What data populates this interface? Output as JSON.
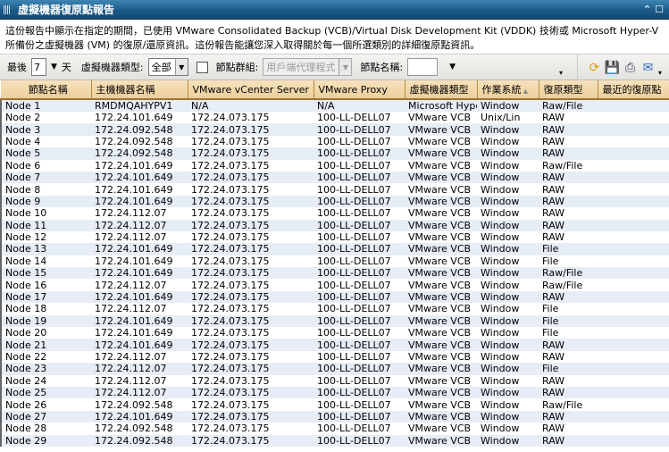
{
  "title": "虛擬機器復原點報告",
  "description": "這份報告中顯示在指定的期間，已使用 VMware Consolidated Backup (VCB)/Virtual Disk Development Kit (VDDK) 技術或 Microsoft Hyper-V 所備份之虛擬機器 (VM) 的復原/還原資訊。這份報告能讓您深入取得關於每一個所選類別的詳細復原點資訊。",
  "toolbar": {
    "last_label": "最後",
    "days_value": "7",
    "days_unit": "天",
    "vm_type_label": "虛擬機器類型:",
    "vm_type_value": "全部",
    "node_group_label": "節點群組:",
    "node_group_value": "用戶端代理程式",
    "node_name_label": "節點名稱:",
    "node_name_value": ""
  },
  "icons": [
    "refresh-icon",
    "save-icon",
    "print-icon",
    "email-icon"
  ],
  "columns": [
    "節點名稱",
    "主機機器名稱",
    "VMware vCenter Server",
    "VMware Proxy",
    "虛擬機器類型",
    "作業系統",
    "復原類型",
    "最近的復原點"
  ],
  "rows": [
    [
      "Node 1",
      "RMDMQAHYPV1",
      "N/A",
      "N/A",
      "Microsoft Hyper-V",
      "Window",
      "Raw/File",
      ""
    ],
    [
      "Node 2",
      "172.24.101.649",
      "172.24.073.175",
      "100-LL-DELL07",
      "VMware VCB",
      "Unix/Lin",
      "RAW",
      ""
    ],
    [
      "Node 3",
      "172.24.092.548",
      "172.24.073.175",
      "100-LL-DELL07",
      "VMware VCB",
      "Window",
      "RAW",
      ""
    ],
    [
      "Node 4",
      "172.24.092.548",
      "172.24.073.175",
      "100-LL-DELL07",
      "VMware VCB",
      "Window",
      "RAW",
      ""
    ],
    [
      "Node 5",
      "172.24.092.548",
      "172.24.073.175",
      "100-LL-DELL07",
      "VMware VCB",
      "Window",
      "RAW",
      ""
    ],
    [
      "Node 6",
      "172.24.101.649",
      "172.24.073.175",
      "100-LL-DELL07",
      "VMware VCB",
      "Window",
      "Raw/File",
      ""
    ],
    [
      "Node 7",
      "172.24.101.649",
      "172.24.073.175",
      "100-LL-DELL07",
      "VMware VCB",
      "Window",
      "RAW",
      ""
    ],
    [
      "Node 8",
      "172.24.101.649",
      "172.24.073.175",
      "100-LL-DELL07",
      "VMware VCB",
      "Window",
      "RAW",
      ""
    ],
    [
      "Node 9",
      "172.24.101.649",
      "172.24.073.175",
      "100-LL-DELL07",
      "VMware VCB",
      "Window",
      "RAW",
      ""
    ],
    [
      "Node 10",
      "172.24.112.07",
      "172.24.073.175",
      "100-LL-DELL07",
      "VMware VCB",
      "Window",
      "RAW",
      ""
    ],
    [
      "Node 11",
      "172.24.112.07",
      "172.24.073.175",
      "100-LL-DELL07",
      "VMware VCB",
      "Window",
      "RAW",
      ""
    ],
    [
      "Node 12",
      "172.24.112.07",
      "172.24.073.175",
      "100-LL-DELL07",
      "VMware VCB",
      "Window",
      "RAW",
      ""
    ],
    [
      "Node 13",
      "172.24.101.649",
      "172.24.073.175",
      "100-LL-DELL07",
      "VMware VCB",
      "Window",
      "File",
      ""
    ],
    [
      "Node 14",
      "172.24.101.649",
      "172.24.073.175",
      "100-LL-DELL07",
      "VMware VCB",
      "Window",
      "File",
      ""
    ],
    [
      "Node 15",
      "172.24.101.649",
      "172.24.073.175",
      "100-LL-DELL07",
      "VMware VCB",
      "Window",
      "Raw/File",
      ""
    ],
    [
      "Node 16",
      "172.24.112.07",
      "172.24.073.175",
      "100-LL-DELL07",
      "VMware VCB",
      "Window",
      "Raw/File",
      ""
    ],
    [
      "Node 17",
      "172.24.101.649",
      "172.24.073.175",
      "100-LL-DELL07",
      "VMware VCB",
      "Window",
      "RAW",
      ""
    ],
    [
      "Node 18",
      "172.24.112.07",
      "172.24.073.175",
      "100-LL-DELL07",
      "VMware VCB",
      "Window",
      "File",
      ""
    ],
    [
      "Node 19",
      "172.24.101.649",
      "172.24.073.175",
      "100-LL-DELL07",
      "VMware VCB",
      "Window",
      "File",
      ""
    ],
    [
      "Node 20",
      "172.24.101.649",
      "172.24.073.175",
      "100-LL-DELL07",
      "VMware VCB",
      "Window",
      "File",
      ""
    ],
    [
      "Node 21",
      "172.24.101.649",
      "172.24.073.175",
      "100-LL-DELL07",
      "VMware VCB",
      "Window",
      "RAW",
      ""
    ],
    [
      "Node 22",
      "172.24.112.07",
      "172.24.073.175",
      "100-LL-DELL07",
      "VMware VCB",
      "Window",
      "RAW",
      ""
    ],
    [
      "Node 23",
      "172.24.112.07",
      "172.24.073.175",
      "100-LL-DELL07",
      "VMware VCB",
      "Window",
      "File",
      ""
    ],
    [
      "Node 24",
      "172.24.112.07",
      "172.24.073.175",
      "100-LL-DELL07",
      "VMware VCB",
      "Window",
      "RAW",
      ""
    ],
    [
      "Node 25",
      "172.24.112.07",
      "172.24.073.175",
      "100-LL-DELL07",
      "VMware VCB",
      "Window",
      "RAW",
      ""
    ],
    [
      "Node 26",
      "172.24.092.548",
      "172.24.073.175",
      "100-LL-DELL07",
      "VMware VCB",
      "Window",
      "Raw/File",
      ""
    ],
    [
      "Node 27",
      "172.24.101.649",
      "172.24.073.175",
      "100-LL-DELL07",
      "VMware VCB",
      "Window",
      "RAW",
      ""
    ],
    [
      "Node 28",
      "172.24.092.548",
      "172.24.073.175",
      "100-LL-DELL07",
      "VMware VCB",
      "Window",
      "RAW",
      ""
    ],
    [
      "Node 29",
      "172.24.092.548",
      "172.24.073.175",
      "100-LL-DELL07",
      "VMware VCB",
      "Window",
      "RAW",
      ""
    ]
  ]
}
